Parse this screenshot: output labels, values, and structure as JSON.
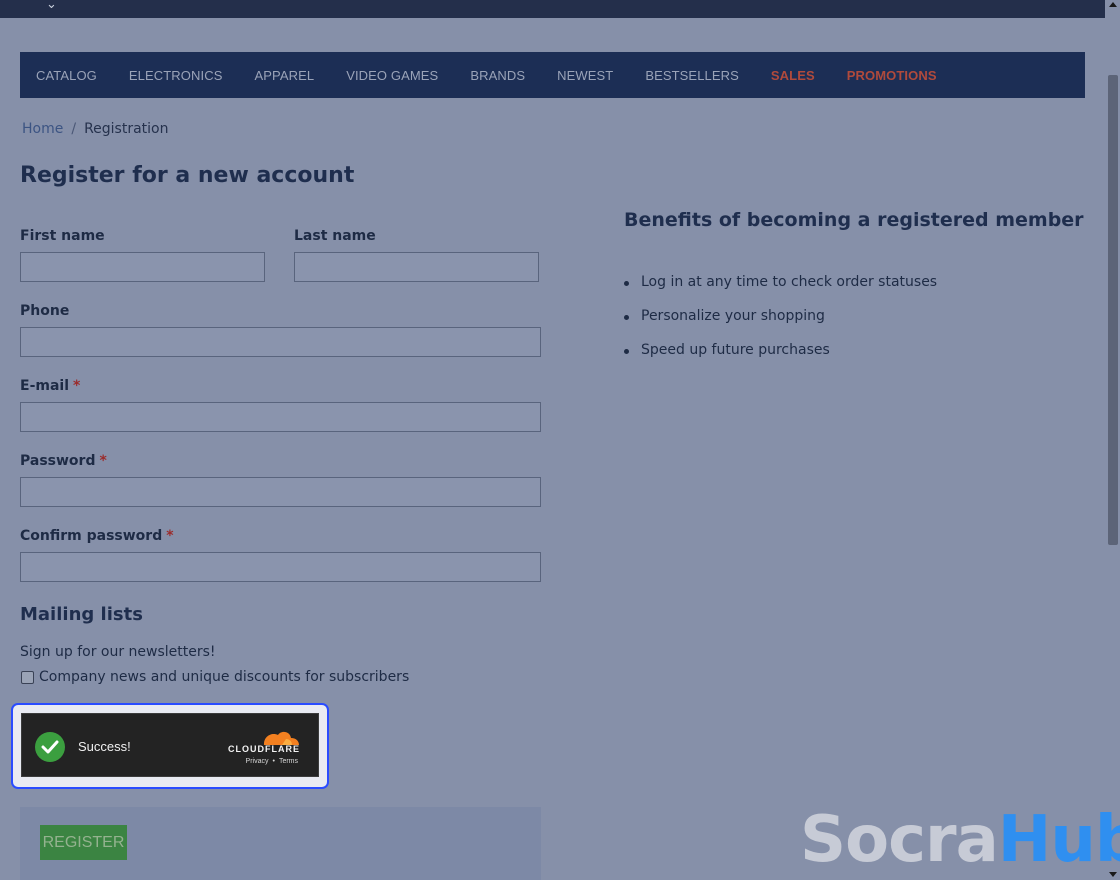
{
  "nav": {
    "items": [
      "CATALOG",
      "ELECTRONICS",
      "APPAREL",
      "VIDEO GAMES",
      "BRANDS",
      "NEWEST",
      "BESTSELLERS",
      "SALES",
      "PROMOTIONS"
    ],
    "highlight_color": "#b04a3c"
  },
  "breadcrumb": {
    "home": "Home",
    "separator": "/",
    "current": "Registration"
  },
  "page": {
    "title": "Register for a new account"
  },
  "form": {
    "first_name_label": "First name",
    "last_name_label": "Last name",
    "phone_label": "Phone",
    "email_label": "E-mail",
    "password_label": "Password",
    "confirm_password_label": "Confirm password",
    "required_marker": "*",
    "first_name_value": "",
    "last_name_value": "",
    "phone_value": "",
    "email_value": "",
    "password_value": "",
    "confirm_password_value": ""
  },
  "mailing": {
    "title": "Mailing lists",
    "text": "Sign up for our newsletters!",
    "checkbox_label": "Company news and unique discounts for subscribers",
    "checked": false
  },
  "captcha": {
    "status": "Success!",
    "brand": "CLOUDFLARE",
    "privacy_label": "Privacy",
    "link_separator": "•",
    "terms_label": "Terms",
    "brand_color": "#f38020",
    "status_color": "#3b9f3f"
  },
  "register": {
    "label": "REGISTER",
    "color": "#3b8442"
  },
  "benefits": {
    "title": "Benefits of becoming a registered member",
    "items": [
      "Log in at any time to check order statuses",
      "Personalize your shopping",
      "Speed up future purchases"
    ]
  },
  "watermark": {
    "part1": "Socra",
    "part2": "Hub"
  }
}
